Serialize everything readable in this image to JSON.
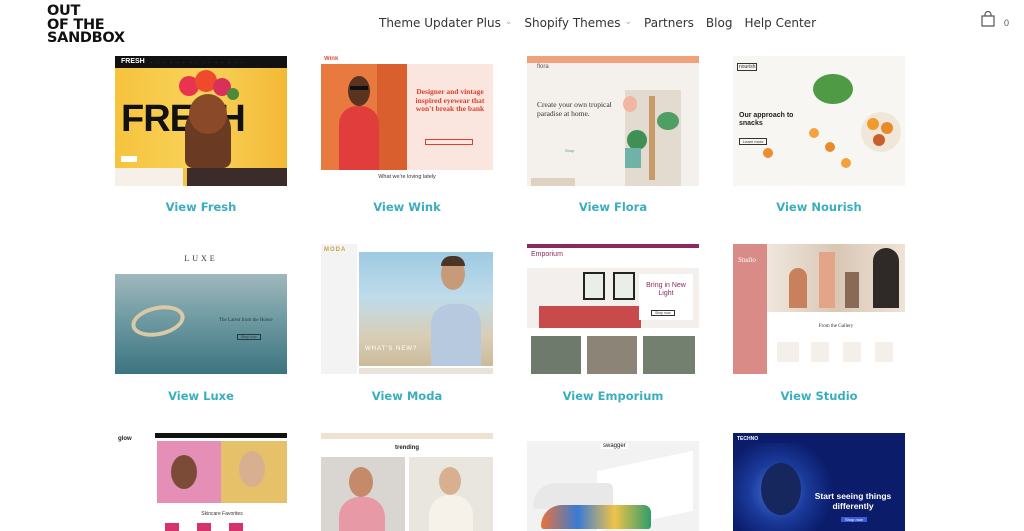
{
  "logo": {
    "lines": [
      "OUT",
      "OF THE",
      "SANDBOX"
    ]
  },
  "nav": {
    "items": [
      {
        "label": "Theme Updater Plus",
        "has_dropdown": true
      },
      {
        "label": "Shopify Themes",
        "has_dropdown": true
      },
      {
        "label": "Partners",
        "has_dropdown": false
      },
      {
        "label": "Blog",
        "has_dropdown": false
      },
      {
        "label": "Help Center",
        "has_dropdown": false
      }
    ],
    "cart_icon": "shopping-bag-icon",
    "cart_count": "0"
  },
  "colors": {
    "link": "#3aaebf",
    "text": "#222222"
  },
  "themes": [
    {
      "name": "Fresh",
      "link_label": "View Fresh",
      "preview": {
        "brand": "FRESH",
        "hero": "FRESH"
      }
    },
    {
      "name": "Wink",
      "link_label": "View Wink",
      "preview": {
        "brand": "Wink",
        "headline": "Designer and vintage inspired eyewear that won't break the bank",
        "button": "Shop the collection",
        "section": "What we're loving lately"
      }
    },
    {
      "name": "Flora",
      "link_label": "View Flora",
      "preview": {
        "brand": "flora",
        "headline": "Create your own tropical paradise at home.",
        "button": "Shop"
      }
    },
    {
      "name": "Nourish",
      "link_label": "View Nourish",
      "preview": {
        "brand": "nourish",
        "headline": "Our approach to snacks",
        "button": "Learn more"
      }
    },
    {
      "name": "Luxe",
      "link_label": "View Luxe",
      "preview": {
        "brand": "LUXE",
        "headline": "The Latest from the House",
        "button": "Shop now"
      }
    },
    {
      "name": "Moda",
      "link_label": "View Moda",
      "preview": {
        "brand": "MODA",
        "headline": "WHAT'S NEW?"
      }
    },
    {
      "name": "Emporium",
      "link_label": "View Emporium",
      "preview": {
        "brand": "Emporium",
        "headline": "Bring in New Light",
        "button": "Shop now"
      }
    },
    {
      "name": "Studio",
      "link_label": "View Studio",
      "preview": {
        "brand": "Studio",
        "section": "From the Gallery"
      }
    },
    {
      "name": "Glow",
      "link_label": "",
      "preview": {
        "brand": "glow",
        "section": "Skincare Favorites"
      }
    },
    {
      "name": "Trending",
      "link_label": "",
      "preview": {
        "brand": "trending"
      }
    },
    {
      "name": "Swagger",
      "link_label": "",
      "preview": {
        "brand": "swagger"
      }
    },
    {
      "name": "Techno",
      "link_label": "",
      "preview": {
        "brand": "TECHNO",
        "headline": "Start seeing things differently",
        "button": "Shop now"
      }
    }
  ]
}
